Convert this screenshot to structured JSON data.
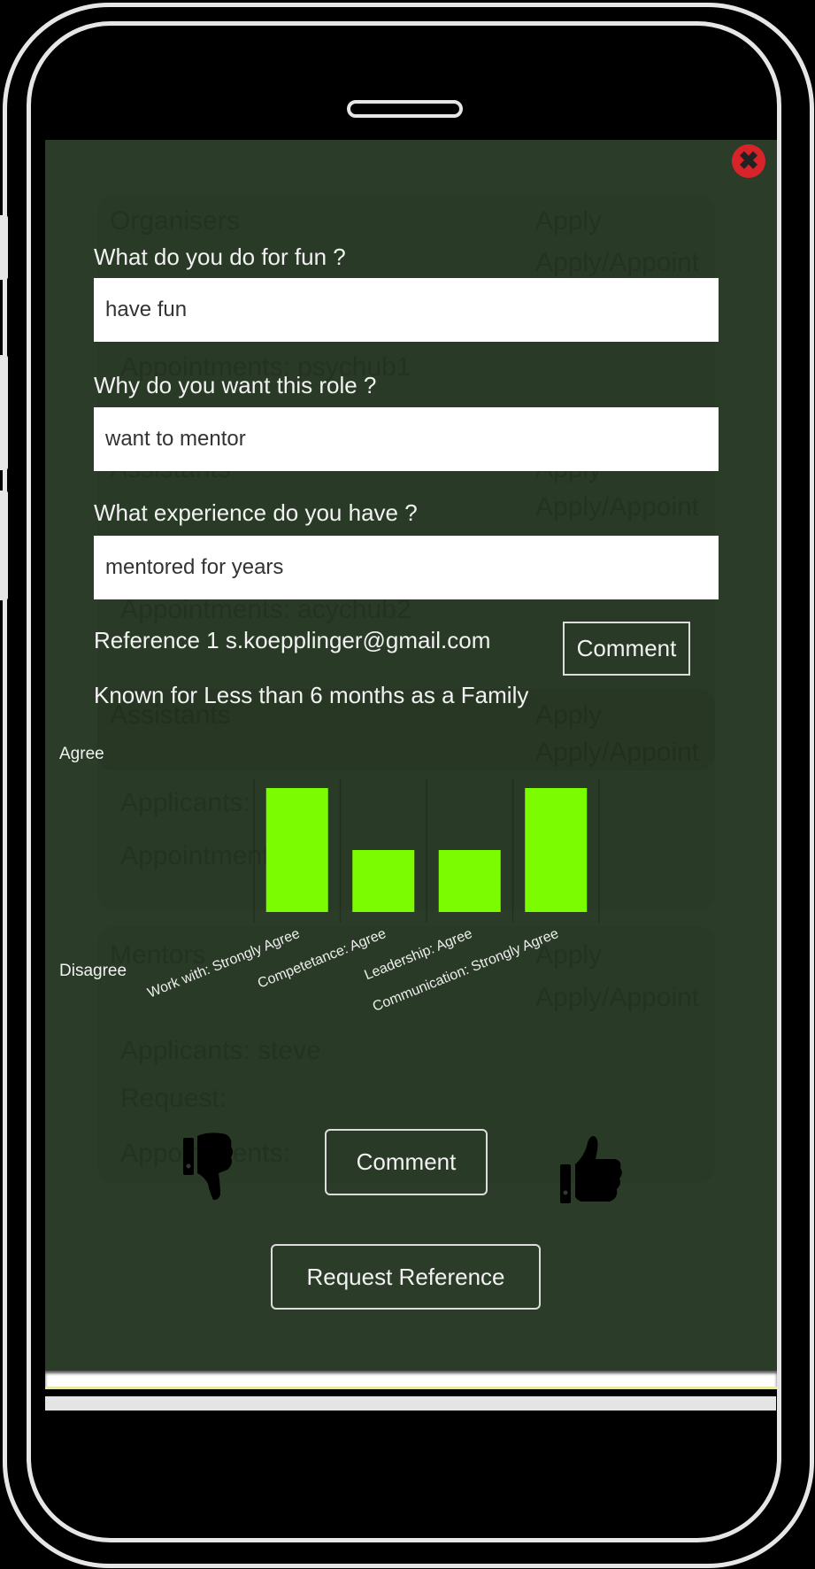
{
  "background_page": {
    "cards": [
      {
        "title": "Organisers",
        "apply": "Apply",
        "apply_appoint": "Apply/Appoint",
        "rows": [
          "Appointments:  psychub1"
        ]
      },
      {
        "title": "Assistants",
        "apply": "Apply",
        "apply_appoint": "Apply/Appoint",
        "rows": [
          "Appointments:  acychub2"
        ]
      },
      {
        "title": "Assistants",
        "apply": "Apply",
        "apply_appoint": "Apply/Appoint",
        "rows": [
          "Applicants:",
          "Appointments:"
        ]
      },
      {
        "title": "Mentors",
        "apply": "Apply",
        "apply_appoint": "Apply/Appoint",
        "rows": [
          "Applicants:   steve",
          "Request:",
          "Appointments:"
        ]
      }
    ]
  },
  "modal": {
    "close_icon": "close-icon",
    "questions": [
      {
        "label": "What do you do for fun ?",
        "value": "have fun"
      },
      {
        "label": "Why do you want this role ?",
        "value": "want to mentor"
      },
      {
        "label": "What experience do you have ?",
        "value": "mentored for years"
      }
    ],
    "reference": {
      "title": "Reference 1 s.koepplinger@gmail.com",
      "comment_label": "Comment",
      "known_for": "Known for Less than 6 months as a Family"
    },
    "actions": {
      "thumbs_down_icon": "thumbs-down-icon",
      "comment_label": "Comment",
      "thumbs_up_icon": "thumbs-up-icon",
      "request_reference_label": "Request Reference"
    }
  },
  "chart_data": {
    "type": "bar",
    "categories": [
      "Work with: Strongly Agree",
      "Competetance: Agree",
      "Leadership: Agree",
      "Communication: Strongly Agree"
    ],
    "values": [
      2,
      1,
      1,
      2
    ],
    "ylim": [
      0,
      2
    ],
    "y_tick_labels": {
      "top": "Agree",
      "bottom": "Disagree"
    },
    "bar_color": "#7cfc00",
    "grid": true
  }
}
